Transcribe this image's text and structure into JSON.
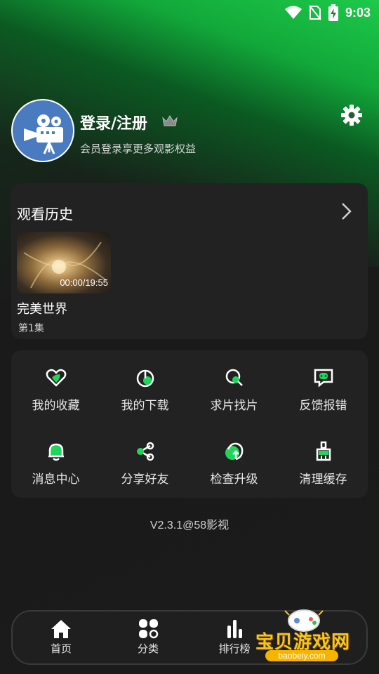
{
  "status_bar": {
    "time": "9:03"
  },
  "profile": {
    "title": "登录/注册",
    "subtitle": "会员登录享更多观影权益"
  },
  "history": {
    "title": "观看历史",
    "items": [
      {
        "title": "完美世界",
        "episode": "第1集",
        "progress": "00:00/19:55"
      }
    ]
  },
  "features": [
    {
      "label": "我的收藏",
      "icon": "favorite-heart-icon"
    },
    {
      "label": "我的下载",
      "icon": "download-icon"
    },
    {
      "label": "求片找片",
      "icon": "search-movie-icon"
    },
    {
      "label": "反馈报错",
      "icon": "feedback-icon"
    },
    {
      "label": "消息中心",
      "icon": "bell-icon"
    },
    {
      "label": "分享好友",
      "icon": "share-icon"
    },
    {
      "label": "检查升级",
      "icon": "upgrade-icon"
    },
    {
      "label": "清理缓存",
      "icon": "broom-icon"
    }
  ],
  "version": "V2.3.1@58影视",
  "bottom_nav": [
    {
      "label": "首页",
      "icon": "home-icon"
    },
    {
      "label": "分类",
      "icon": "category-icon"
    },
    {
      "label": "排行榜",
      "icon": "ranking-icon"
    }
  ],
  "watermark": {
    "text": "宝贝游戏网",
    "url": "baobeiy.com"
  },
  "colors": {
    "accent": "#1fd65a",
    "card": "#222222",
    "background": "#1b1b1b"
  }
}
